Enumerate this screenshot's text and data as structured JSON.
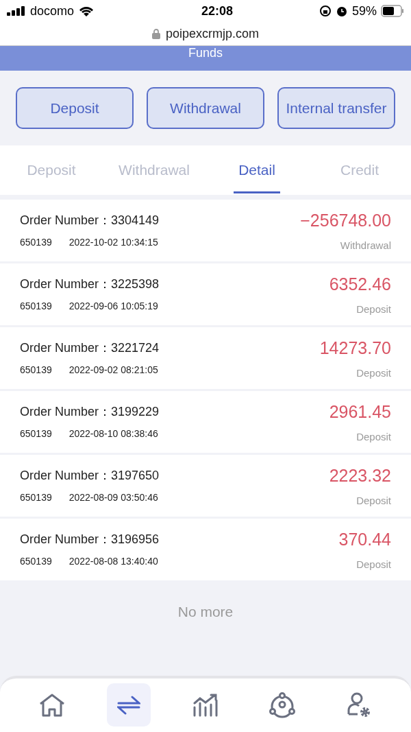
{
  "status_bar": {
    "carrier": "docomo",
    "time": "22:08",
    "battery": "59%"
  },
  "browser": {
    "url": "poipexcrmjp.com"
  },
  "header": {
    "title": "Funds"
  },
  "actions": [
    "Deposit",
    "Withdrawal",
    "Internal transfer"
  ],
  "tabs": [
    {
      "label": "Deposit",
      "selected": false
    },
    {
      "label": "Withdrawal",
      "selected": false
    },
    {
      "label": "Detail",
      "selected": true
    },
    {
      "label": "Credit",
      "selected": false
    }
  ],
  "records": [
    {
      "order_label": "Order Number：",
      "order_number": "3304149",
      "account": "650139",
      "datetime": "2022-10-02 10:34:15",
      "amount": "−256748.00",
      "type": "Withdrawal"
    },
    {
      "order_label": "Order Number：",
      "order_number": "3225398",
      "account": "650139",
      "datetime": "2022-09-06 10:05:19",
      "amount": "6352.46",
      "type": "Deposit"
    },
    {
      "order_label": "Order Number：",
      "order_number": "3221724",
      "account": "650139",
      "datetime": "2022-09-02 08:21:05",
      "amount": "14273.70",
      "type": "Deposit"
    },
    {
      "order_label": "Order Number：",
      "order_number": "3199229",
      "account": "650139",
      "datetime": "2022-08-10 08:38:46",
      "amount": "2961.45",
      "type": "Deposit"
    },
    {
      "order_label": "Order Number：",
      "order_number": "3197650",
      "account": "650139",
      "datetime": "2022-08-09 03:50:46",
      "amount": "2223.32",
      "type": "Deposit"
    },
    {
      "order_label": "Order Number：",
      "order_number": "3196956",
      "account": "650139",
      "datetime": "2022-08-08 13:40:40",
      "amount": "370.44",
      "type": "Deposit"
    }
  ],
  "end_text": "No more",
  "nav": [
    {
      "kind": "home",
      "selected": false
    },
    {
      "kind": "transfer",
      "selected": true
    },
    {
      "kind": "chart",
      "selected": false
    },
    {
      "kind": "network",
      "selected": false
    },
    {
      "kind": "user",
      "selected": false
    }
  ]
}
